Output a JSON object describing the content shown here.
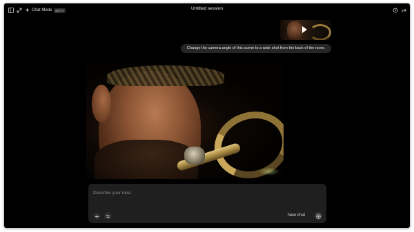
{
  "topbar": {
    "sidebar_icon": "sidebar-toggle-icon",
    "expand_icon": "expand-icon",
    "mode_label": "Chat Mode",
    "mode_badge": "BETA",
    "session_title": "Untitled session",
    "right_icons": [
      "history-icon",
      "share-icon"
    ]
  },
  "conversation": {
    "attachment": "video-thumbnail",
    "user_message": "Change the camera angle of this scene to a wide shot from the back of the room."
  },
  "composer": {
    "placeholder": "Describe your idea",
    "value": "",
    "new_chat_label": "New chat",
    "add_icon": "plus-icon",
    "settings_icon": "sliders-icon",
    "send_icon": "record-icon"
  },
  "colors": {
    "background": "#000000",
    "bubble": "#262626",
    "composer": "#1f1f1f",
    "text": "#ececec",
    "muted_text": "#8a8a8a"
  }
}
